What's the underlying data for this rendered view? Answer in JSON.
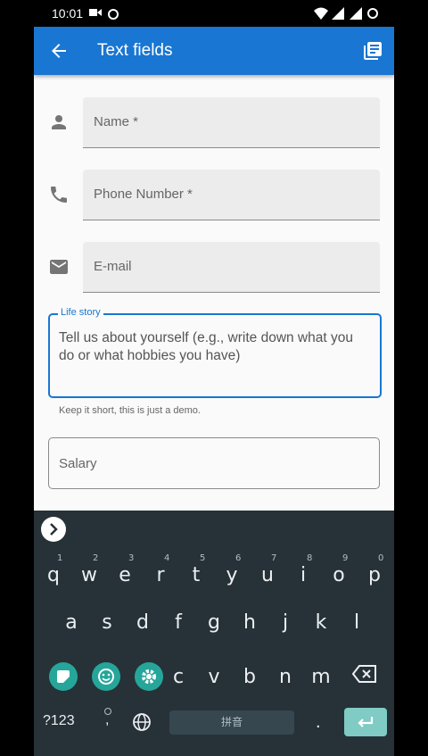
{
  "status": {
    "time": "10:01"
  },
  "appbar": {
    "title": "Text fields"
  },
  "fields": {
    "name": "Name *",
    "phone": "Phone Number *",
    "email": "E-mail",
    "life_story": {
      "label": "Life story",
      "hint": "Tell us about yourself (e.g., write down what you do or what hobbies you have)",
      "helper": "Keep it short, this is just a demo."
    },
    "salary": "Salary"
  },
  "keyboard": {
    "row1": [
      "q",
      "w",
      "e",
      "r",
      "t",
      "y",
      "u",
      "i",
      "o",
      "p"
    ],
    "row1_sup": [
      "1",
      "2",
      "3",
      "4",
      "5",
      "6",
      "7",
      "8",
      "9",
      "0"
    ],
    "row2": [
      "a",
      "s",
      "d",
      "f",
      "g",
      "h",
      "j",
      "k",
      "l"
    ],
    "row3": [
      "c",
      "v",
      "b",
      "n",
      "m"
    ],
    "symbols": "?123",
    "comma": ",",
    "period": ".",
    "space": "拼音"
  },
  "colors": {
    "primary": "#1976d2",
    "keyboard_bg": "#263238",
    "accent": "#26a69a"
  }
}
